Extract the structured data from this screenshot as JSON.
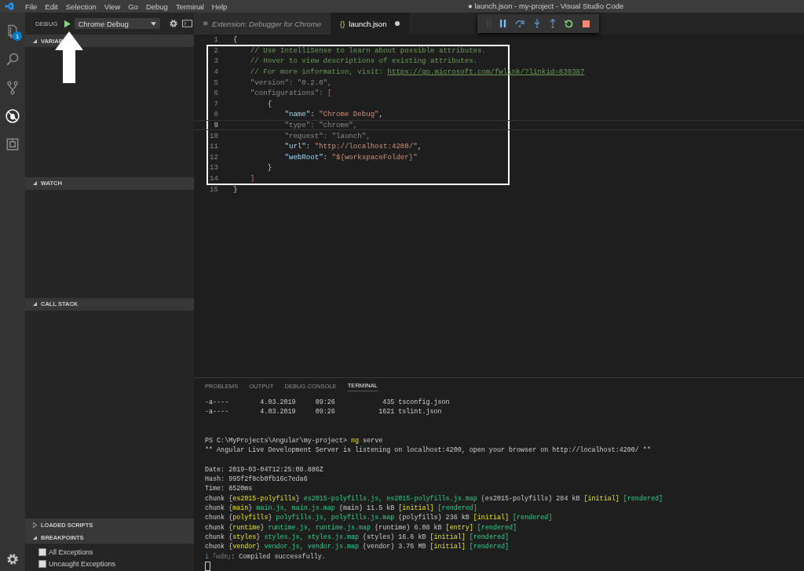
{
  "window": {
    "title": "● launch.json - my-project - Visual Studio Code"
  },
  "menu": [
    "File",
    "Edit",
    "Selection",
    "View",
    "Go",
    "Debug",
    "Terminal",
    "Help"
  ],
  "activity_bar": [
    {
      "kind": "files",
      "badge": "1",
      "selected": false
    },
    {
      "kind": "search",
      "selected": false
    },
    {
      "kind": "scm",
      "selected": false
    },
    {
      "kind": "debug",
      "selected": true
    },
    {
      "kind": "extensions",
      "selected": false
    }
  ],
  "debug_header": {
    "label": "DEBUG",
    "configuration": "Chrome Debug"
  },
  "sidebar_sections": [
    {
      "title": "VARIAB",
      "expanded": true
    },
    {
      "title": "WATCH",
      "expanded": true
    },
    {
      "title": "CALL STACK",
      "expanded": true
    },
    {
      "title": "LOADED SCRIPTS",
      "expanded": false
    },
    {
      "title": "BREAKPOINTS",
      "expanded": true,
      "items": [
        {
          "label": "All Exceptions",
          "checked": false
        },
        {
          "label": "Uncaught Exceptions",
          "checked": false
        }
      ]
    }
  ],
  "editor_tabs": [
    {
      "label": "Extension: Debugger for Chrome",
      "kind": "preview",
      "selected": false,
      "modified": false
    },
    {
      "label": "launch.json",
      "kind": "json",
      "icon_text": "{}",
      "selected": true,
      "modified": true
    }
  ],
  "editor_lines": [
    {
      "number": "1",
      "current": false,
      "tokens": [
        {
          "kind": "punct",
          "text": "{"
        }
      ]
    },
    {
      "number": "2",
      "current": false,
      "tokens": [
        {
          "kind": "comment",
          "text": "    // Use IntelliSense to learn about possible attributes."
        }
      ]
    },
    {
      "number": "3",
      "current": false,
      "tokens": [
        {
          "kind": "comment",
          "text": "    // Hover to view descriptions of existing attributes."
        }
      ]
    },
    {
      "number": "4",
      "current": false,
      "tokens": [
        {
          "kind": "comment",
          "text": "    // For more information, visit: "
        },
        {
          "kind": "link",
          "text": "https://go.microsoft.com/fwlink/?linkid=830387"
        }
      ]
    },
    {
      "number": "5",
      "current": false,
      "tokens": [
        {
          "kind": "dim",
          "text": "    \"version\": \"0.2.0\","
        }
      ]
    },
    {
      "number": "6",
      "current": false,
      "tokens": [
        {
          "kind": "dim",
          "text": "    \"configurations\": "
        },
        {
          "kind": "bracket",
          "text": "["
        }
      ]
    },
    {
      "number": "7",
      "current": false,
      "tokens": [
        {
          "kind": "punct",
          "text": "        {"
        }
      ]
    },
    {
      "number": "8",
      "current": false,
      "tokens": [
        {
          "kind": "key",
          "text": "            \"name\""
        },
        {
          "kind": "punct",
          "text": ": "
        },
        {
          "kind": "string",
          "text": "\"Chrome Debug\""
        },
        {
          "kind": "punct",
          "text": ","
        }
      ]
    },
    {
      "number": "9",
      "current": true,
      "tokens": [
        {
          "kind": "dim",
          "text": "            \"type\": \"chrome\","
        }
      ]
    },
    {
      "number": "10",
      "current": false,
      "tokens": [
        {
          "kind": "dim",
          "text": "            \"request\": \"launch\","
        }
      ]
    },
    {
      "number": "11",
      "current": false,
      "tokens": [
        {
          "kind": "key",
          "text": "            \"url\""
        },
        {
          "kind": "punct",
          "text": ": "
        },
        {
          "kind": "string",
          "text": "\"http://localhost:4200/\""
        },
        {
          "kind": "punct",
          "text": ","
        }
      ]
    },
    {
      "number": "12",
      "current": false,
      "tokens": [
        {
          "kind": "key",
          "text": "            \"webRoot\""
        },
        {
          "kind": "punct",
          "text": ": "
        },
        {
          "kind": "string",
          "text": "\"${workspaceFolder}\""
        }
      ]
    },
    {
      "number": "13",
      "current": false,
      "tokens": [
        {
          "kind": "punct",
          "text": "        }"
        }
      ]
    },
    {
      "number": "14",
      "current": false,
      "tokens": [
        {
          "kind": "bracket",
          "text": "    ]"
        }
      ]
    },
    {
      "number": "15",
      "current": false,
      "tokens": [
        {
          "kind": "punct",
          "text": "}"
        }
      ]
    }
  ],
  "panel_tabs": [
    {
      "label": "PROBLEMS",
      "selected": false
    },
    {
      "label": "OUTPUT",
      "selected": false
    },
    {
      "label": "DEBUG CONSOLE",
      "selected": false
    },
    {
      "label": "TERMINAL",
      "selected": true
    }
  ],
  "terminal_blocks": [
    [
      [
        {
          "kind": "plain",
          "text": "-a----        4.03.2019     09:26            435 tsconfig.json"
        }
      ],
      [
        {
          "kind": "plain",
          "text": "-a----        4.03.2019     09:26           1621 tslint.json"
        }
      ]
    ],
    [
      [
        {
          "kind": "plain",
          "text": "PS C:\\MyProjects\\Angular\\my-project> "
        },
        {
          "kind": "yellow",
          "text": "ng"
        },
        {
          "kind": "plain",
          "text": " serve"
        }
      ],
      [
        {
          "kind": "plain",
          "text": "** Angular Live Development Server is listening on localhost:4200, open your browser on http://localhost:4200/ **"
        }
      ]
    ],
    [
      [
        {
          "kind": "plain",
          "text": "Date: 2019-03-04T12:25:08.886Z"
        }
      ],
      [
        {
          "kind": "plain",
          "text": "Hash: 995f2f8cb0fb16c7eda6"
        }
      ],
      [
        {
          "kind": "plain",
          "text": "Time: 8520ms"
        }
      ],
      [
        {
          "kind": "plain",
          "text": "chunk {"
        },
        {
          "kind": "yellow",
          "text": "es2015-polyfills"
        },
        {
          "kind": "plain",
          "text": "} "
        },
        {
          "kind": "green",
          "text": "es2015-polyfills.js, es2015-polyfills.js.map"
        },
        {
          "kind": "plain",
          "text": " (es2015-polyfills) 284 kB "
        },
        {
          "kind": "yellow",
          "text": "[initial] "
        },
        {
          "kind": "green",
          "text": "[rendered]"
        }
      ],
      [
        {
          "kind": "plain",
          "text": "chunk {"
        },
        {
          "kind": "yellow",
          "text": "main"
        },
        {
          "kind": "plain",
          "text": "} "
        },
        {
          "kind": "green",
          "text": "main.js, main.js.map"
        },
        {
          "kind": "plain",
          "text": " (main) 11.5 kB "
        },
        {
          "kind": "yellow",
          "text": "[initial] "
        },
        {
          "kind": "green",
          "text": "[rendered]"
        }
      ],
      [
        {
          "kind": "plain",
          "text": "chunk {"
        },
        {
          "kind": "yellow",
          "text": "polyfills"
        },
        {
          "kind": "plain",
          "text": "} "
        },
        {
          "kind": "green",
          "text": "polyfills.js, polyfills.js.map"
        },
        {
          "kind": "plain",
          "text": " (polyfills) 236 kB "
        },
        {
          "kind": "yellow",
          "text": "[initial] "
        },
        {
          "kind": "green",
          "text": "[rendered]"
        }
      ],
      [
        {
          "kind": "plain",
          "text": "chunk {"
        },
        {
          "kind": "yellow",
          "text": "runtime"
        },
        {
          "kind": "plain",
          "text": "} "
        },
        {
          "kind": "green",
          "text": "runtime.js, runtime.js.map"
        },
        {
          "kind": "plain",
          "text": " (runtime) 6.08 kB "
        },
        {
          "kind": "yellow",
          "text": "[entry] "
        },
        {
          "kind": "green",
          "text": "[rendered]"
        }
      ],
      [
        {
          "kind": "plain",
          "text": "chunk {"
        },
        {
          "kind": "yellow",
          "text": "styles"
        },
        {
          "kind": "plain",
          "text": "} "
        },
        {
          "kind": "green",
          "text": "styles.js, styles.js.map"
        },
        {
          "kind": "plain",
          "text": " (styles) 16.6 kB "
        },
        {
          "kind": "yellow",
          "text": "[initial] "
        },
        {
          "kind": "green",
          "text": "[rendered]"
        }
      ],
      [
        {
          "kind": "plain",
          "text": "chunk {"
        },
        {
          "kind": "yellow",
          "text": "vendor"
        },
        {
          "kind": "plain",
          "text": "} "
        },
        {
          "kind": "green",
          "text": "vendor.js, vendor.js.map"
        },
        {
          "kind": "plain",
          "text": " (vendor) 3.76 MB "
        },
        {
          "kind": "yellow",
          "text": "[initial] "
        },
        {
          "kind": "green",
          "text": "[rendered]"
        }
      ],
      [
        {
          "kind": "blue",
          "text": "i"
        },
        {
          "kind": "gray",
          "text": " ｢wdm｣"
        },
        {
          "kind": "plain",
          "text": ": Compiled successfully."
        }
      ]
    ]
  ]
}
